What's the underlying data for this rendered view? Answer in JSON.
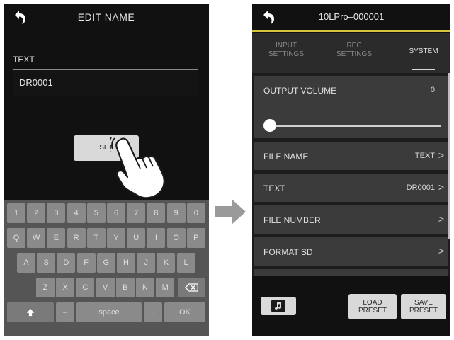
{
  "left_screen": {
    "title": "EDIT NAME",
    "text_label": "TEXT",
    "text_value": "DR0001",
    "set_button": "SET",
    "keyboard": {
      "row1": [
        "1",
        "2",
        "3",
        "4",
        "5",
        "6",
        "7",
        "8",
        "9",
        "0"
      ],
      "row2": [
        "Q",
        "W",
        "E",
        "R",
        "T",
        "Y",
        "U",
        "I",
        "O",
        "P"
      ],
      "row3": [
        "A",
        "S",
        "D",
        "F",
        "G",
        "H",
        "J",
        "K",
        "L"
      ],
      "row4": [
        "Z",
        "X",
        "C",
        "V",
        "B",
        "N",
        "M"
      ],
      "row5": {
        "dash": "–",
        "space": "space",
        "dot": ".",
        "ok": "OK"
      },
      "backspace_icon": "backspace-icon",
      "shift_icon": "shift-arrow-icon"
    }
  },
  "arrow_icon": "right-arrow-icon",
  "hand_icon": "pointing-hand-icon",
  "right_screen": {
    "title": "10LPro–000001",
    "tabs": [
      {
        "line1": "INPUT",
        "line2": "SETTINGS"
      },
      {
        "line1": "REC",
        "line2": "SETTINGS"
      },
      {
        "line1": "SYSTEM",
        "line2": ""
      }
    ],
    "active_tab": "SYSTEM",
    "output_volume": {
      "label": "OUTPUT VOLUME",
      "value": "0"
    },
    "rows": [
      {
        "label": "FILE NAME",
        "value": "TEXT"
      },
      {
        "label": "TEXT",
        "value": "DR0001"
      },
      {
        "label": "FILE NUMBER",
        "value": ""
      },
      {
        "label": "FORMAT SD",
        "value": ""
      }
    ],
    "chevron": ">",
    "bottom": {
      "music_icon": "music-note-icon",
      "load": {
        "line1": "LOAD",
        "line2": "PRESET"
      },
      "save": {
        "line1": "SAVE",
        "line2": "PRESET"
      }
    }
  },
  "colors": {
    "accent": "#d6c23b",
    "background": "#111111",
    "row": "#3b3b3b",
    "keyboard": "#555555",
    "key": "#8a8a8a"
  }
}
